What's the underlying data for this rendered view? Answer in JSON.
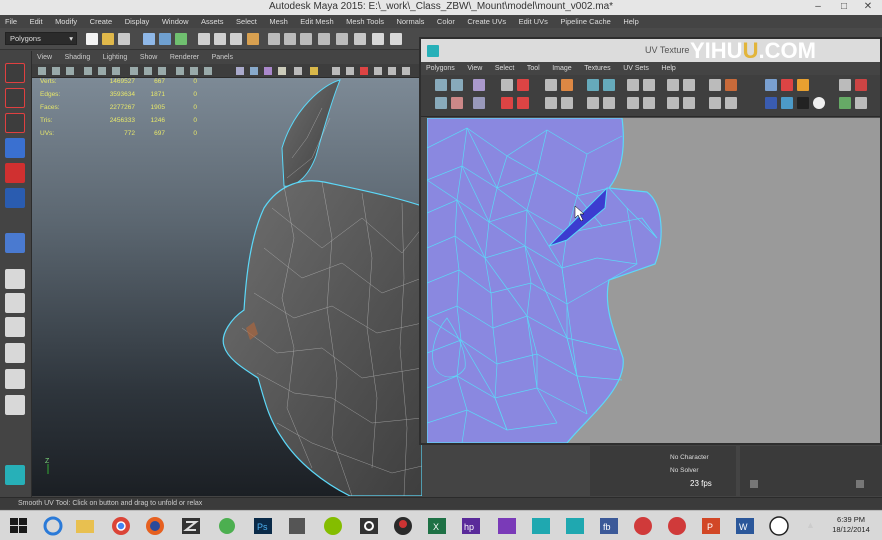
{
  "title_bar": {
    "title": "Autodesk Maya 2015: E:\\_work\\_Class_ZBW\\_Mount\\model\\mount_v002.ma*",
    "minimize": "–",
    "maximize": "□",
    "close": "✕"
  },
  "menu_bar": [
    "File",
    "Edit",
    "Modify",
    "Create",
    "Display",
    "Window",
    "Assets",
    "Select",
    "Mesh",
    "Edit Mesh",
    "Mesh Tools",
    "Normals",
    "Color",
    "Create UVs",
    "Edit UVs",
    "Pipeline Cache",
    "Help"
  ],
  "status_line": {
    "mode": "Polygons"
  },
  "viewport": {
    "menu": [
      "View",
      "Shading",
      "Lighting",
      "Show",
      "Renderer",
      "Panels"
    ],
    "hud": [
      {
        "label": "Verts:",
        "v1": "1469527",
        "v2": "667",
        "v3": "0"
      },
      {
        "label": "Edges:",
        "v1": "3593634",
        "v2": "1871",
        "v3": "0"
      },
      {
        "label": "Faces:",
        "v1": "2277267",
        "v2": "1905",
        "v3": "0"
      },
      {
        "label": "Tris:",
        "v1": "2456333",
        "v2": "1246",
        "v3": "0"
      },
      {
        "label": "UVs:",
        "v1": "772",
        "v2": "697",
        "v3": "0"
      }
    ],
    "axis_label": "Z"
  },
  "uv_editor": {
    "title": "UV Texture",
    "menu": [
      "Polygons",
      "View",
      "Select",
      "Tool",
      "Image",
      "Textures",
      "UV Sets",
      "Help"
    ]
  },
  "watermark": {
    "part1": "YI",
    "part2": "HU",
    "part3": "U",
    "part4": ".COM"
  },
  "channel_box": {
    "character": "No Character",
    "solver": "No Solver",
    "fps": "23 fps"
  },
  "help_line": "Smooth UV Tool: Click on button and drag to unfold or relax",
  "taskbar": {
    "time": "6:39 PM",
    "date": "18/12/2014",
    "apps": [
      "start",
      "internet-explorer",
      "file-explorer",
      "chrome",
      "firefox",
      "zbrush",
      "android-app",
      "photoshop",
      "app-icon",
      "spotify",
      "app-q",
      "app-dark",
      "excel",
      "hp",
      "app-purple",
      "maya",
      "maya",
      "facebook",
      "app-s",
      "app-s2",
      "powerpoint",
      "word",
      "unreal"
    ]
  },
  "colors": {
    "uv_shell": "#8a88e0",
    "wire": "#5cd8f8",
    "selection": "#3c3cd0",
    "viewport_top": "#7d8a96",
    "viewport_bottom": "#1b1f24",
    "accent_yellow": "#e2b53b"
  }
}
